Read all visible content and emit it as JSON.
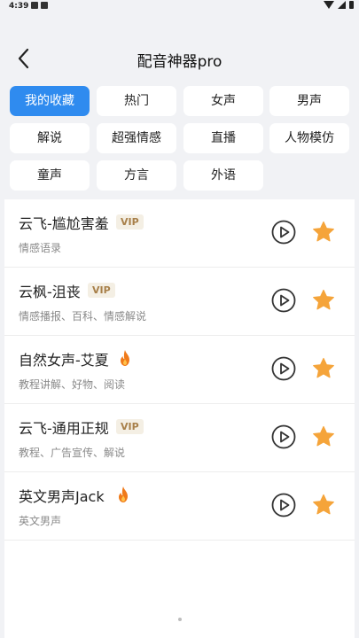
{
  "status_bar": {
    "time": "4:39"
  },
  "header": {
    "title": "配音神器pro"
  },
  "categories": [
    "我的收藏",
    "热门",
    "女声",
    "男声",
    "解说",
    "超强情感",
    "直播",
    "人物模仿",
    "童声",
    "方言",
    "外语"
  ],
  "active_category": "我的收藏",
  "voices": [
    {
      "name": "云飞-尴尬害羞",
      "badge": "VIP",
      "desc": "情感语录"
    },
    {
      "name": "云枫-沮丧",
      "badge": "VIP",
      "desc": "情感播报、百科、情感解说"
    },
    {
      "name": "自然女声-艾夏",
      "badge": "fire",
      "desc": "教程讲解、好物、阅读"
    },
    {
      "name": "云飞-通用正规",
      "badge": "VIP",
      "desc": "教程、广告宣传、解说"
    },
    {
      "name": "英文男声Jack",
      "badge": "fire",
      "desc": "英文男声"
    }
  ],
  "colors": {
    "accent": "#2f8bef",
    "star": "#f5a43a",
    "vip_text": "#a8804a",
    "vip_bg": "#f4efe4",
    "flame": "#f07a1a"
  },
  "icons": {
    "back": "chevron-left-icon",
    "play": "play-circle-icon",
    "favorite": "star-icon",
    "hot": "fire-icon"
  }
}
